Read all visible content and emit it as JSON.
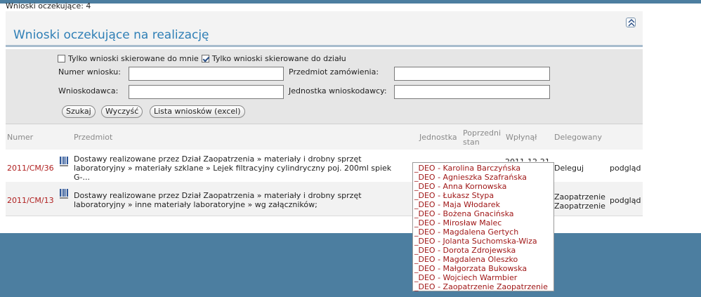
{
  "pending_count_text": "Wnioski oczekujące: 4",
  "panel": {
    "title": "Wnioski oczekujące na realizację",
    "collapse_icon": "double-chevron-up-icon"
  },
  "filters": {
    "only_mine_label": "Tylko wnioski skierowane do mnie",
    "only_mine_checked": false,
    "only_dept_label": "Tylko wnioski skierowane do działu",
    "only_dept_checked": true,
    "request_number_label": "Numer wniosku:",
    "request_number_value": "",
    "order_subject_label": "Przedmiot zamówienia:",
    "order_subject_value": "",
    "applicant_label": "Wnioskodawca:",
    "applicant_value": "",
    "applicant_unit_label": "Jednostka wnioskodawcy:",
    "applicant_unit_value": "",
    "search_button": "Szukaj",
    "clear_button": "Wyczyść",
    "export_button": "Lista wniosków (excel)"
  },
  "table": {
    "columns": {
      "number": "Numer",
      "subject": "Przedmiot",
      "unit": "Jednostka",
      "prev_state_line1": "Poprzedni",
      "prev_state_line2": "stan",
      "received": "Wpłynął",
      "delegated": "Delegowany"
    },
    "rows": [
      {
        "number": "2011/CM/36",
        "subject": "Dostawy realizowane przez Dział Zaopatrzenia » materiały i drobny sprzęt laboratoryjny » materiały szklane » Lejek filtracyjny cylindryczny poj. 200ml spiek G-...",
        "received_partial": "2011-12-21",
        "delegated": "Deleguj",
        "action": "podgląd"
      },
      {
        "number": "2011/CM/13",
        "subject": "Dostawy realizowane przez Dział Zaopatrzenia » materiały i drobny sprzęt laboratoryjny » inne materiały laboratoryjne » wg załączników;",
        "delegated_line1": "Zaopatrzenie",
        "delegated_line2": "Zaopatrzenie",
        "action": "podgląd"
      }
    ]
  },
  "delegate_dropdown": {
    "options": [
      "_DEO - Karolina Barczyńska",
      "_DEO - Agnieszka Szafrańska",
      "_DEO - Anna Kornowska",
      "_DEO - Łukasz Stypa",
      "_DEO - Maja Włodarek",
      "_DEO - Bożena Gnacińska",
      "_DEO - Mirosław Malec",
      "_DEO - Magdalena Gertych",
      "_DEO - Jolanta Suchomska-Wiza",
      "_DEO - Dorota Zdrojewska",
      "_DEO - Magdalena Oleszko",
      "_DEO - Małgorzata Bukowska",
      "_DEO - Wojciech Warmbier",
      "_DEO - Zaopatrzenie Zaopatrzenie"
    ]
  },
  "colors": {
    "accent_blue": "#2f7fb6",
    "frame_blue": "#4c7ea0",
    "link_red": "#b02020"
  }
}
